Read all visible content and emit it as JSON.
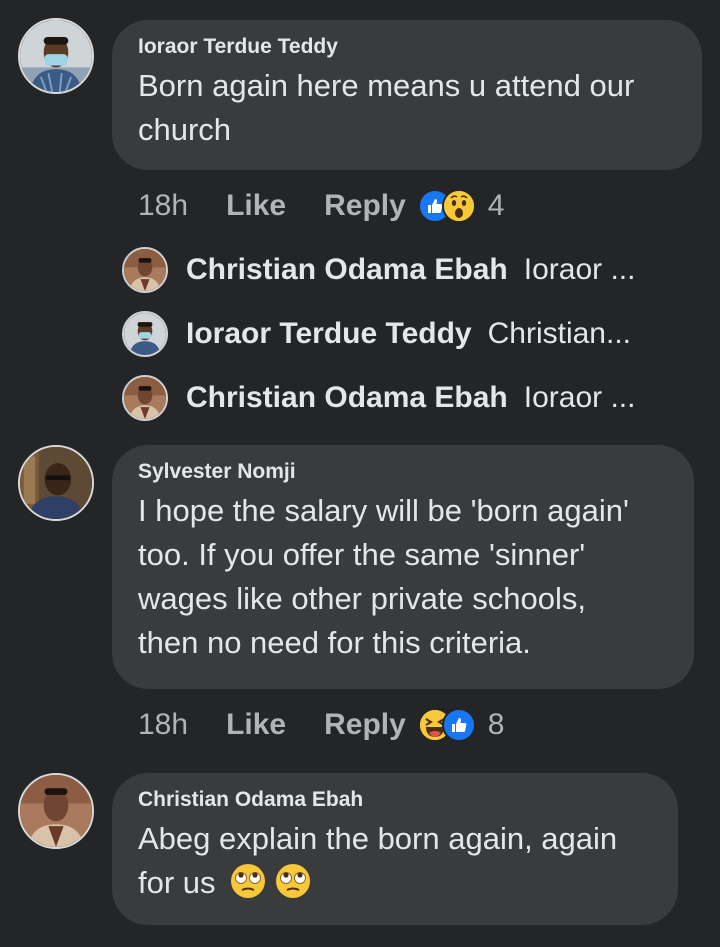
{
  "comments": [
    {
      "author": "Ioraor Terdue Teddy",
      "text_lines": [
        "Born again here means u attend our",
        "church"
      ],
      "time": "18h",
      "like_label": "Like",
      "reply_label": "Reply",
      "reactions": [
        "like",
        "wow"
      ],
      "reaction_count": "4",
      "replies": [
        {
          "author": "Christian Odama Ebah",
          "snippet": "Ioraor ..."
        },
        {
          "author": "Ioraor Terdue Teddy",
          "snippet": "Christian..."
        },
        {
          "author": "Christian Odama Ebah",
          "snippet": "Ioraor ..."
        }
      ]
    },
    {
      "author": "Sylvester Nomji",
      "text_lines": [
        "I hope the salary will be 'born again'",
        "too. If you offer the same 'sinner'",
        "wages like other private schools,",
        "then no need for this criteria."
      ],
      "time": "18h",
      "like_label": "Like",
      "reply_label": "Reply",
      "reactions": [
        "haha",
        "like"
      ],
      "reaction_count": "8"
    },
    {
      "author": "Christian Odama Ebah",
      "text_lines": [
        "Abeg explain the born again, again",
        "for us"
      ],
      "emojis": [
        "face-with-rolling-eyes",
        "face-with-rolling-eyes"
      ]
    }
  ],
  "colors": {
    "background": "#242526",
    "bubble": "#3a3b3c",
    "text": "#e4e6eb",
    "muted": "#b0b3b8",
    "like_blue": "#1877f2",
    "emoji_yellow": "#f7c93a"
  }
}
